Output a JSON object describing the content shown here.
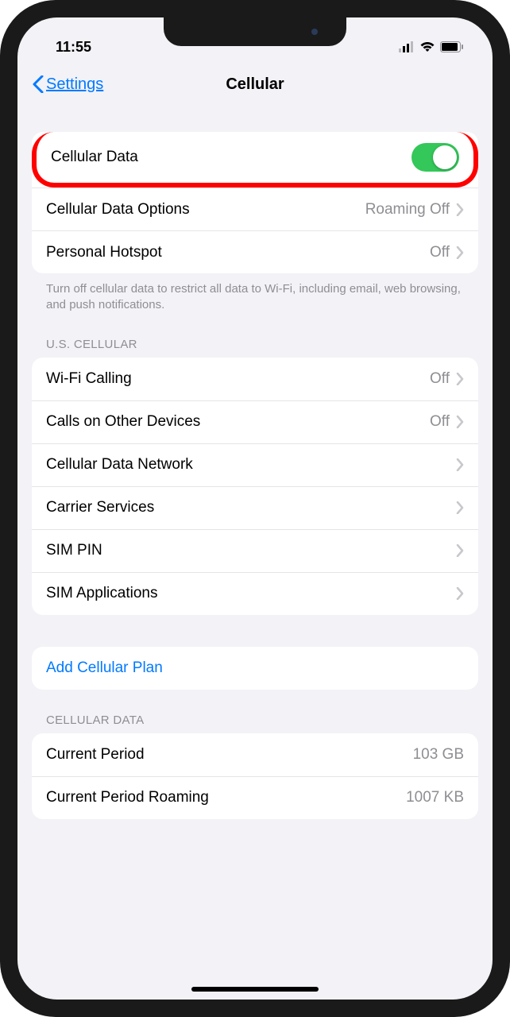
{
  "status": {
    "time": "11:55"
  },
  "nav": {
    "back_label": "Settings",
    "title": "Cellular"
  },
  "group1": {
    "items": [
      {
        "label": "Cellular Data",
        "toggle": true
      },
      {
        "label": "Cellular Data Options",
        "value": "Roaming Off"
      },
      {
        "label": "Personal Hotspot",
        "value": "Off"
      }
    ],
    "footer": "Turn off cellular data to restrict all data to Wi-Fi, including email, web browsing, and push notifications."
  },
  "group2": {
    "header": "U.S. CELLULAR",
    "items": [
      {
        "label": "Wi-Fi Calling",
        "value": "Off"
      },
      {
        "label": "Calls on Other Devices",
        "value": "Off"
      },
      {
        "label": "Cellular Data Network",
        "value": ""
      },
      {
        "label": "Carrier Services",
        "value": ""
      },
      {
        "label": "SIM PIN",
        "value": ""
      },
      {
        "label": "SIM Applications",
        "value": ""
      }
    ]
  },
  "group3": {
    "items": [
      {
        "label": "Add Cellular Plan"
      }
    ]
  },
  "group4": {
    "header": "CELLULAR DATA",
    "items": [
      {
        "label": "Current Period",
        "value": "103 GB"
      },
      {
        "label": "Current Period Roaming",
        "value": "1007 KB"
      }
    ]
  }
}
